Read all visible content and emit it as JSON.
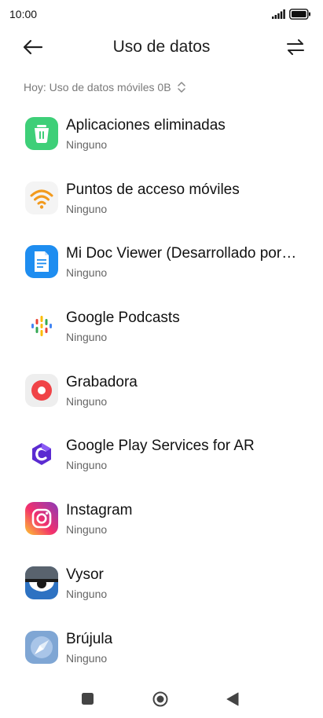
{
  "status": {
    "time": "10:00"
  },
  "header": {
    "title": "Uso de datos"
  },
  "usage_selector": {
    "label": "Hoy: Uso de datos móviles 0B"
  },
  "apps": [
    {
      "name": "Aplicaciones eliminadas",
      "usage": "Ninguno",
      "icon": "trash-icon"
    },
    {
      "name": "Puntos de acceso móviles",
      "usage": "Ninguno",
      "icon": "wifi-hotspot-icon"
    },
    {
      "name": "Mi Doc Viewer (Desarrollado por…",
      "usage": "Ninguno",
      "icon": "document-icon"
    },
    {
      "name": "Google Podcasts",
      "usage": "Ninguno",
      "icon": "podcasts-icon"
    },
    {
      "name": "Grabadora",
      "usage": "Ninguno",
      "icon": "recorder-icon"
    },
    {
      "name": "Google Play Services for AR",
      "usage": "Ninguno",
      "icon": "ar-services-icon"
    },
    {
      "name": "Instagram",
      "usage": "Ninguno",
      "icon": "instagram-icon"
    },
    {
      "name": "Vysor",
      "usage": "Ninguno",
      "icon": "vysor-icon"
    },
    {
      "name": "Brújula",
      "usage": "Ninguno",
      "icon": "compass-icon"
    }
  ]
}
